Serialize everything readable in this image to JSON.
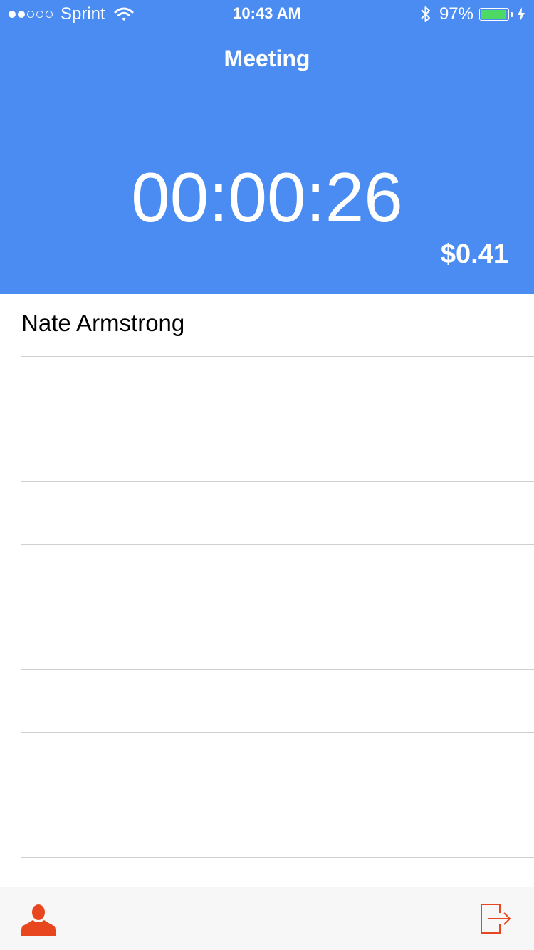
{
  "status_bar": {
    "signal_bars": 5,
    "signal_filled": 2,
    "carrier": "Sprint",
    "time": "10:43 AM",
    "battery_percent": "97%",
    "battery_level": 0.97,
    "icons": [
      "wifi-icon",
      "bluetooth-icon",
      "battery-icon",
      "charging-bolt-icon"
    ]
  },
  "header": {
    "title": "Meeting",
    "timer": "00:00:26",
    "cost": "$0.41",
    "background_color": "#4b8cf2"
  },
  "attendees": {
    "rows": [
      "Nate Armstrong",
      "",
      "",
      "",
      "",
      "",
      "",
      "",
      "",
      ""
    ]
  },
  "toolbar": {
    "left_icon": "person-icon",
    "right_icon": "exit-icon",
    "accent_color": "#e8461e"
  }
}
